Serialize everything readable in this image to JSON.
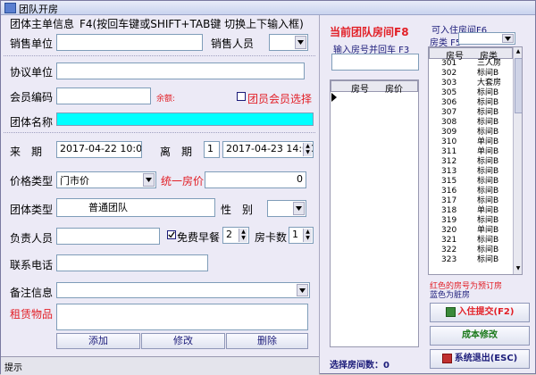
{
  "window": {
    "title": "团队开房"
  },
  "left": {
    "header": "团体主单信息",
    "hint": "F4(按回车键或SHIFT+TAB键 切换上下输入框)",
    "sales_unit_label": "销售单位",
    "sales_unit_value": "",
    "salesperson_label": "销售人员",
    "salesperson_value": "",
    "agreement_unit_label": "协议单位",
    "agreement_unit_value": "",
    "member_code_label": "会员编码",
    "member_code_value": "",
    "balance_label": "余额:",
    "group_member_select_label": "团员会员选择",
    "group_name_label": "团体名称",
    "group_name_value": "",
    "arrive_label": "来　期",
    "arrive_value": "2017-04-22 10:02",
    "depart_label": "离　期",
    "nights_value": "1",
    "depart_value": "2017-04-23 14:00",
    "price_type_label": "价格类型",
    "price_type_value": "门市价",
    "unified_price_label": "统一房价",
    "unified_price_value": "0",
    "group_type_label": "团体类型",
    "group_type_value": "普通团队",
    "gender_label": "性　别",
    "gender_value": "",
    "leader_label": "负责人员",
    "leader_value": "",
    "free_breakfast_label": "免费早餐",
    "free_breakfast_checked": true,
    "free_breakfast_count": "2",
    "room_cards_label": "房卡数",
    "room_cards_value": "1",
    "phone_label": "联系电话",
    "phone_value": "",
    "remark_label": "备注信息",
    "remark_value": "",
    "rental_label": "租赁物品",
    "rental_value": "",
    "add_button": "添加",
    "edit_button": "修改",
    "delete_button": "删除",
    "status_text": "提示"
  },
  "middle": {
    "title": "当前团队房间F8",
    "input_hint": "输入房号并回车 F3",
    "input_value": "",
    "col_room": "房号",
    "col_price": "房价",
    "selected_count_label": "选择房间数：",
    "selected_count_value": "0"
  },
  "right": {
    "title": "可入住房间F6",
    "room_type_label": "房类 F5",
    "room_type_value": "",
    "col_room": "房号",
    "col_type": "房类",
    "rooms": [
      [
        "301",
        "三人房"
      ],
      [
        "302",
        "标间B"
      ],
      [
        "303",
        "大套房"
      ],
      [
        "305",
        "标间B"
      ],
      [
        "306",
        "标间B"
      ],
      [
        "307",
        "标间B"
      ],
      [
        "308",
        "标间B"
      ],
      [
        "309",
        "标间B"
      ],
      [
        "310",
        "单间B"
      ],
      [
        "311",
        "单间B"
      ],
      [
        "312",
        "标间B"
      ],
      [
        "313",
        "标间B"
      ],
      [
        "315",
        "标间B"
      ],
      [
        "316",
        "标间B"
      ],
      [
        "317",
        "标间B"
      ],
      [
        "318",
        "单间B"
      ],
      [
        "319",
        "标间B"
      ],
      [
        "320",
        "单间B"
      ],
      [
        "321",
        "标间B"
      ],
      [
        "322",
        "标间B"
      ],
      [
        "323",
        "标间B"
      ]
    ],
    "legend_line1": "红色的房号为预订房",
    "legend_line2": "蓝色为脏房",
    "checkin_button": "入住提交(F2)",
    "cost_edit_button": "成本修改",
    "exit_button": "系统退出(ESC)"
  },
  "colors": {
    "accent_red": "#e21f26",
    "cyan": "#00ffff",
    "navy": "#1c1c7a"
  }
}
